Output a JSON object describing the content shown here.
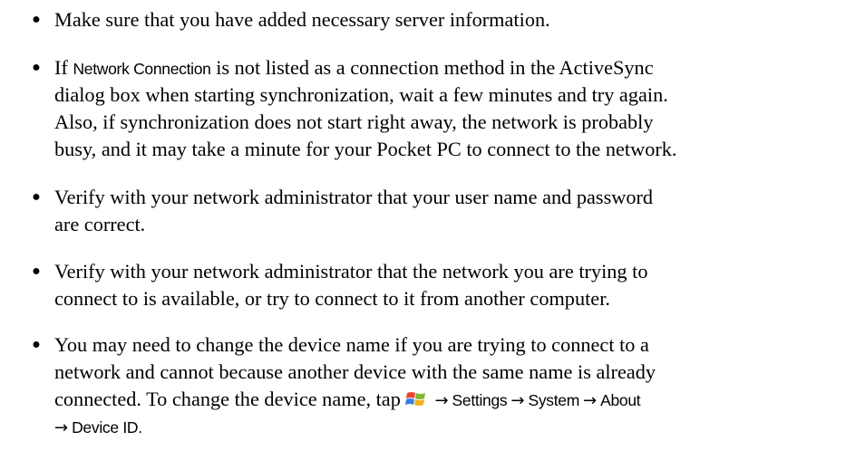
{
  "bullets": [
    {
      "lines": [
        "Make sure that you have added necessary server information."
      ]
    },
    {
      "l1_pre": "If ",
      "l1_ui": "Network Connection",
      "l1_post": " is not listed as a connection method in the ActiveSync",
      "l2": "dialog box when starting synchronization, wait a few minutes and try again.",
      "l3": "Also, if synchronization does not start right away, the network is probably",
      "l4": "busy, and it may take a minute for your Pocket PC to connect to the network."
    },
    {
      "lines": [
        "Verify with your network administrator that your user name and password",
        "are correct."
      ]
    },
    {
      "lines": [
        "Verify with your network administrator that the network you are trying to",
        "connect to is available, or try to connect to it from another computer."
      ]
    },
    {
      "l1": "You may need to change the device name if you are trying to connect to a",
      "l2": "network and cannot because another device with the same name is already",
      "l3_pre": "connected. To change the device name, tap ",
      "arrow": "→",
      "path": [
        "Settings",
        "System",
        "About",
        "Device ID."
      ]
    }
  ],
  "bullet_glyph": "●",
  "icons": {
    "start_menu": "windows-flag-icon"
  },
  "colors": {
    "text": "#000000",
    "flag_red": "#e8462b",
    "flag_green": "#7cbb32",
    "flag_blue": "#3a7de0",
    "flag_yellow": "#f2b21b"
  }
}
